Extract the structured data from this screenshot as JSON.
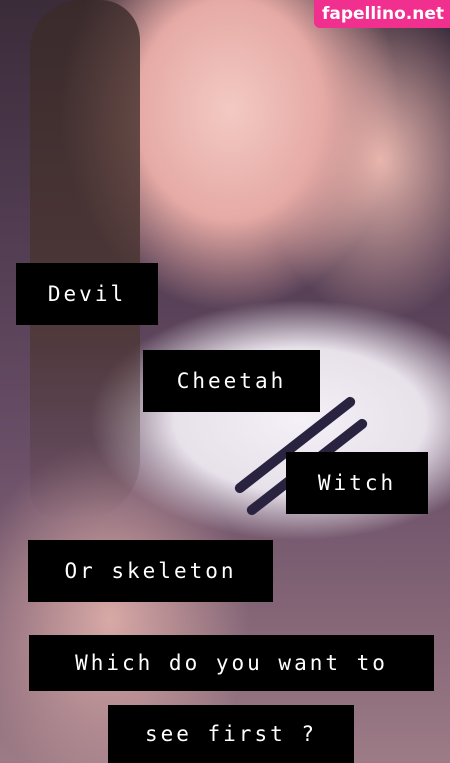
{
  "watermark": {
    "text": "fapellino.net",
    "color": "#f02f8f"
  },
  "captions": [
    {
      "text": "Devil"
    },
    {
      "text": "Cheetah"
    },
    {
      "text": "Witch"
    },
    {
      "text": "Or skeleton"
    },
    {
      "text": "Which do you want to"
    },
    {
      "text": "see first ?"
    }
  ],
  "colors": {
    "caption_background": "#000000",
    "caption_text": "#ffffff"
  }
}
